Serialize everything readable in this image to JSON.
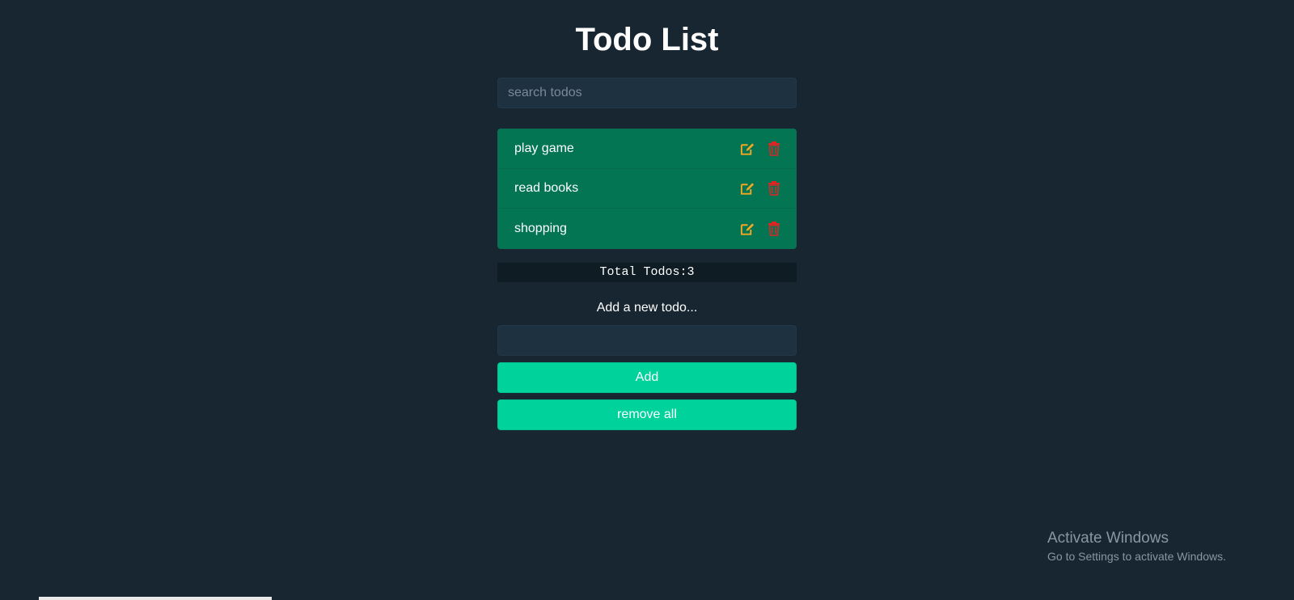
{
  "app": {
    "title": "Todo List"
  },
  "search": {
    "placeholder": "search todos",
    "value": ""
  },
  "todos": [
    {
      "text": "play game",
      "edit_icon": "edit-icon",
      "delete_icon": "trash-icon"
    },
    {
      "text": "read books",
      "edit_icon": "edit-icon",
      "delete_icon": "trash-icon"
    },
    {
      "text": "shopping",
      "edit_icon": "edit-icon",
      "delete_icon": "trash-icon"
    }
  ],
  "summary": {
    "total_label": "Total Todos:3"
  },
  "add_form": {
    "label": "Add a new todo...",
    "input_value": "",
    "add_button": "Add",
    "remove_all_button": "remove all"
  },
  "watermark": {
    "title": "Activate Windows",
    "subtitle": "Go to Settings to activate Windows."
  },
  "colors": {
    "background": "#172631",
    "input_bg": "#1e3140",
    "todo_bg": "#037553",
    "button_bg": "#00d29c",
    "edit_icon": "#f5a623",
    "delete_icon": "#e02424",
    "total_bg": "#0f1c24"
  }
}
